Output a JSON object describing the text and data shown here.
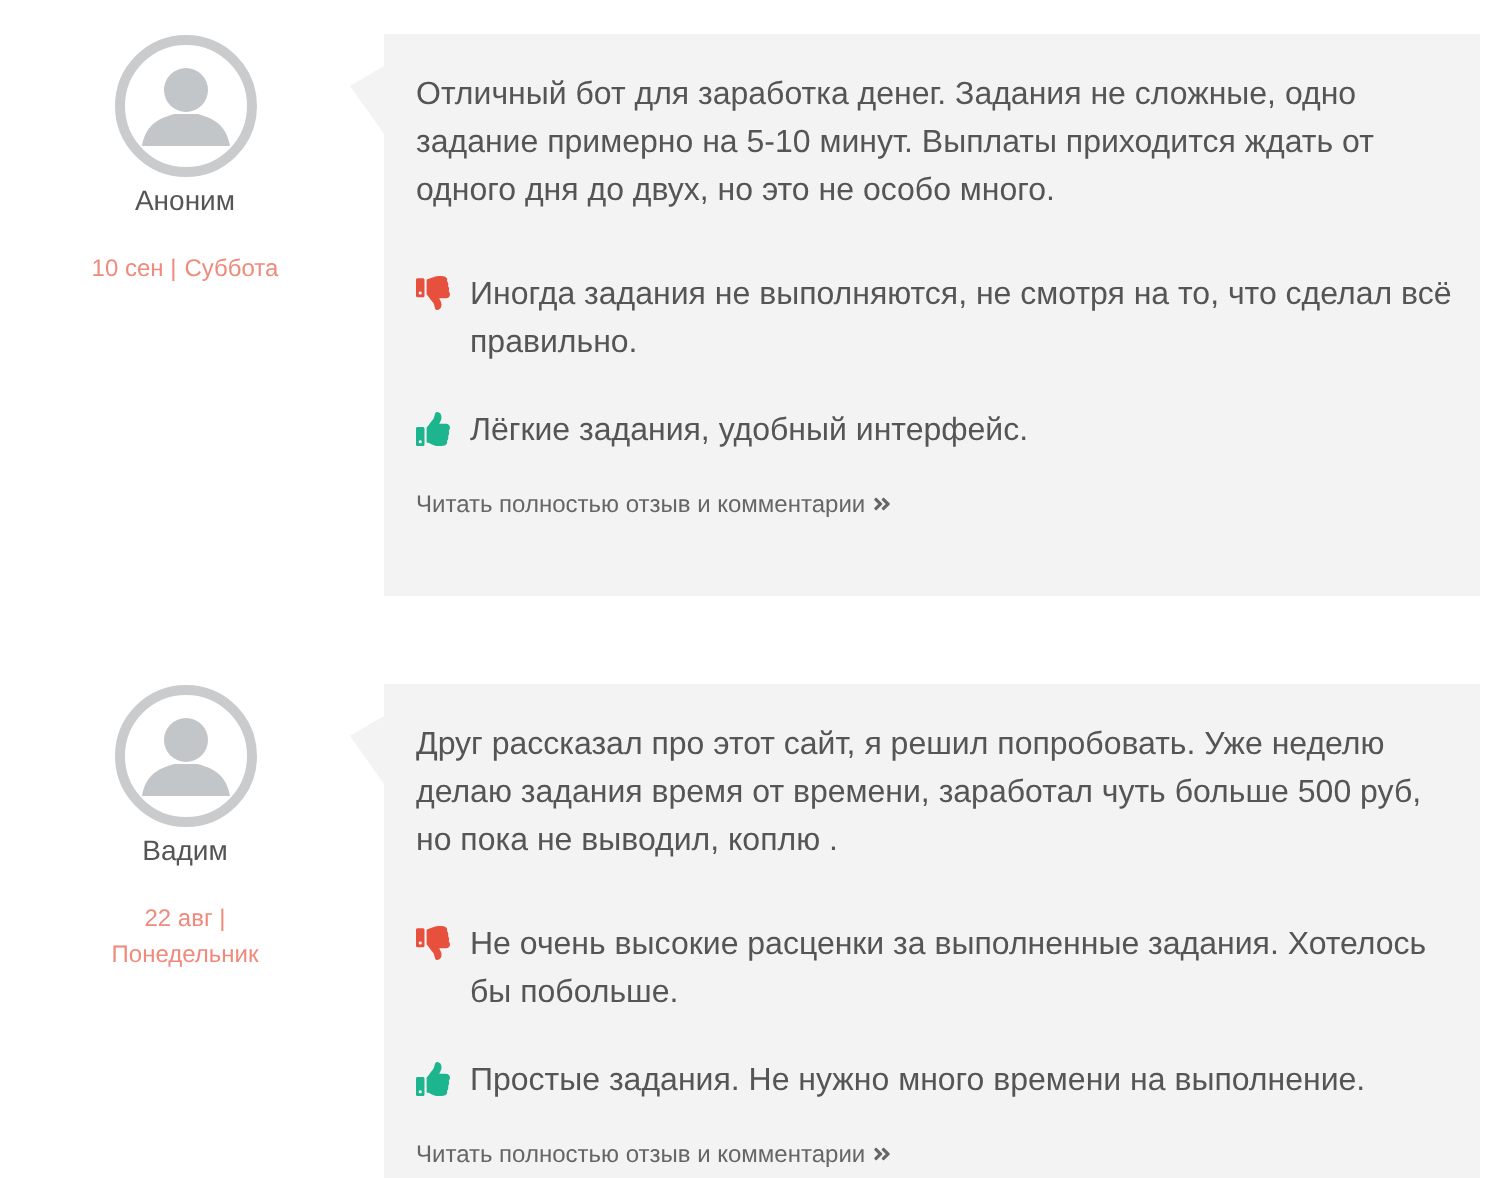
{
  "reviews": [
    {
      "author": "Аноним",
      "date": "10 сен |",
      "weekday": "Суббота",
      "text": "Отличный бот для заработка денег. Задания не сложные, одно задание примерно на 5-10 минут. Выплаты приходится ждать от одного дня до двух, но это не особо много.",
      "points": [
        {
          "kind": "con",
          "text": "Иногда задания не выполняются, не смотря на то, что сделал всё правильно."
        },
        {
          "kind": "pro",
          "text": "Лёгкие задания, удобный интерфейс."
        }
      ],
      "link": "Читать полностью отзыв и комментарии"
    },
    {
      "author": "Вадим",
      "date": "22 авг |",
      "weekday": "Понедельник",
      "text": "Друг рассказал про этот сайт, я решил попробовать. Уже неделю делаю задания время от времени, заработал чуть больше 500 руб, но пока не выводил, коплю .",
      "points": [
        {
          "kind": "con",
          "text": "Не очень высокие расценки за выполненные задания. Хотелось бы побольше."
        },
        {
          "kind": "pro",
          "text": "Простые задания. Не нужно много времени на выполнение."
        }
      ],
      "link": "Читать полностью отзыв и комментарии"
    }
  ]
}
